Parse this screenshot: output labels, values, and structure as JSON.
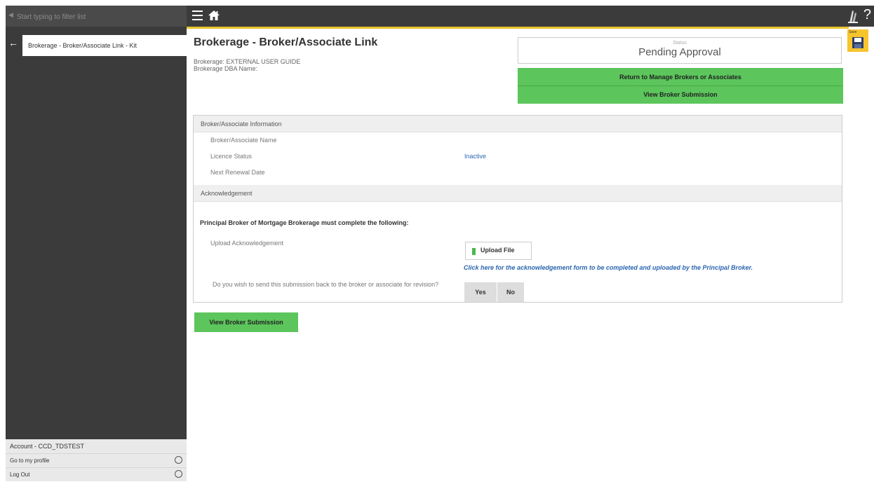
{
  "sidebar": {
    "filter_placeholder": "Start typing to filter list",
    "nav_item_label": "Brokerage - Broker/Associate Link - Kit",
    "account_label": "Account - CCD_TDSTEST",
    "profile_link": "Go to my profile",
    "logout_link": "Log Out"
  },
  "header": {
    "help_label": "?"
  },
  "save": {
    "label": "Save"
  },
  "main": {
    "title": "Brokerage - Broker/Associate Link",
    "brokerage_line": "Brokerage: EXTERNAL USER GUIDE",
    "dba_line": "Brokerage DBA Name:",
    "status_caption": "Status",
    "status_value": "Pending Approval",
    "return_button": "Return to Manage Brokers or Associates",
    "view_submission_top": "View Broker Submission",
    "view_submission_bottom": "View Broker Submission"
  },
  "broker_info": {
    "section_title": "Broker/Associate Information",
    "name_label": "Broker/Associate Name",
    "licence_status_label": "Licence Status",
    "licence_status_value": "Inactive",
    "renewal_label": "Next Renewal Date"
  },
  "acknowledgement": {
    "section_title": "Acknowledgement",
    "principal_heading": "Principal Broker of Mortgage Brokerage must complete the following:",
    "upload_label": "Upload Acknowledgement",
    "upload_button": "Upload File",
    "form_link": "Click here for the acknowledgement form to be completed and uploaded by the Principal Broker.",
    "revision_question": "Do you wish to send this submission back to the broker or associate for revision?",
    "yes": "Yes",
    "no": "No"
  },
  "colors": {
    "accent_green": "#5cc55c",
    "accent_yellow": "#f6c52e",
    "dark_bar": "#3b3b3b",
    "link_blue": "#2a66b0"
  },
  "icons": [
    "search-icon",
    "back-arrow-icon",
    "menu-icon",
    "home-icon",
    "logo-icon",
    "help-icon",
    "save-icon",
    "upload-icon",
    "gear-icon"
  ]
}
